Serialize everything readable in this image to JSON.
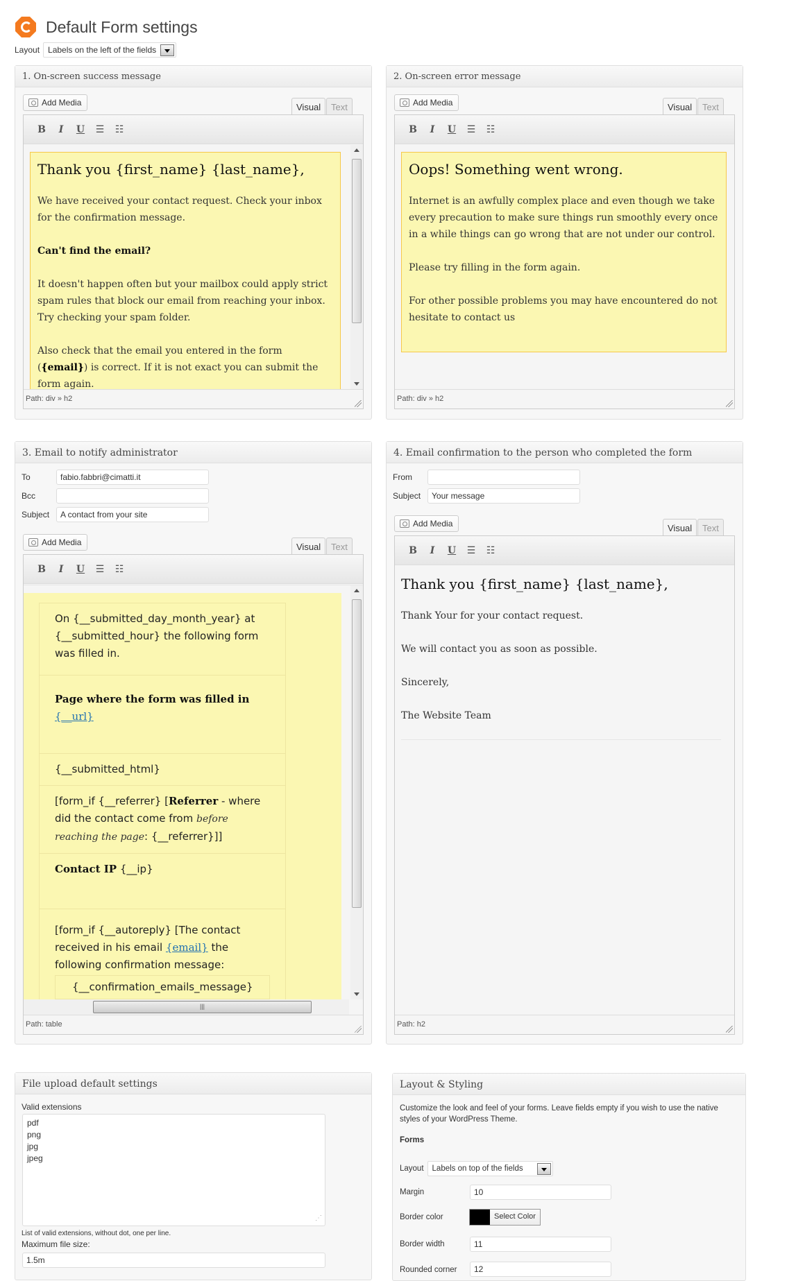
{
  "header": {
    "title": "Default Form settings",
    "logo_icon": "cimatti-logo-icon",
    "layout_label": "Layout",
    "layout_value": "Labels on the left of the fields"
  },
  "editor_common": {
    "add_media": "Add Media",
    "tab_visual": "Visual",
    "tab_text": "Text",
    "toolbar": [
      "B",
      "I",
      "U",
      "bullet-list",
      "numbered-list"
    ]
  },
  "success": {
    "title": "1. On-screen success message",
    "heading": "Thank you {first_name} {last_name},",
    "p1": "We have received your contact request. Check your inbox for the confirmation message.",
    "p2": "Can't find the email?",
    "p3": "It doesn't happen often but your mailbox could apply strict spam rules that block our email from reaching your inbox. Try checking your spam folder.",
    "p4_before": "Also check that the email you entered in the form (",
    "p4_bold": "{email}",
    "p4_after": ") is correct. If it is not exact you can submit the form again.",
    "path": "Path: div » h2"
  },
  "error": {
    "title": "2. On-screen error message",
    "heading": "Oops! Something went wrong.",
    "p1": "Internet is an awfully complex place and even though we take every precaution to make sure things run smoothly every once in a while things can go wrong that are not under our control.",
    "p2": "Please try filling in the form again.",
    "p3": "For other possible problems you may have encountered do not hesitate to contact us",
    "path": "Path: div » h2"
  },
  "admin": {
    "title": "3. Email to notify administrator",
    "to_label": "To",
    "to_value": "fabio.fabbri@cimatti.it",
    "bcc_label": "Bcc",
    "bcc_value": "",
    "subject_label": "Subject",
    "subject_value": "A contact from your site",
    "row1": "On {__submitted_day_month_year} at {__submitted_hour} the following form was filled in.",
    "row2_bold": "Page where the form was filled in",
    "row2_link": "{__url}",
    "row3": "{__submitted_html}",
    "row4_a": "[form_if {__referrer} [",
    "row4_bold": "Referrer",
    "row4_b": " - where did the contact come from ",
    "row4_italic": "before reaching the page",
    "row4_c": ": {__referrer}]]",
    "row5_bold": "Contact IP",
    "row5_text": " {__ip}",
    "row6_a": "[form_if {__autoreply} [The contact received in his email ",
    "row6_link": "{email}",
    "row6_b": " the following confirmation message:",
    "row6_box": "{__confirmation_emails_message}",
    "row6_end": "]]",
    "path": "Path: table"
  },
  "confirm": {
    "title": "4. Email confirmation to the person who completed the form",
    "from_label": "From",
    "from_value": "",
    "subject_label": "Subject",
    "subject_value": "Your message",
    "heading": "Thank you {first_name} {last_name},",
    "p1": "Thank Your for your contact request.",
    "p2": "We will contact you as soon as possible.",
    "p3": "Sincerely,",
    "p4": "The Website Team",
    "path": "Path: h2"
  },
  "upload": {
    "title": "File upload default settings",
    "ext_label": "Valid extensions",
    "extensions": [
      "pdf",
      "png",
      "jpg",
      "jpeg"
    ],
    "ext_help": "List of valid extensions, without dot, one per line.",
    "max_label": "Maximum file size:",
    "max_value": "1.5m"
  },
  "styling": {
    "title": "Layout & Styling",
    "intro": "Customize the look and feel of your forms. Leave fields empty if you wish to use the native styles of your WordPress Theme.",
    "forms_heading": "Forms",
    "layout_label": "Layout",
    "layout_value": "Labels on top of the fields",
    "margin_label": "Margin",
    "margin_value": "10",
    "border_color_label": "Border color",
    "border_color_value": "#000000",
    "select_color": "Select Color",
    "border_width_label": "Border width",
    "border_width_value": "11",
    "rounded_label": "Rounded corner",
    "rounded_value": "12"
  }
}
